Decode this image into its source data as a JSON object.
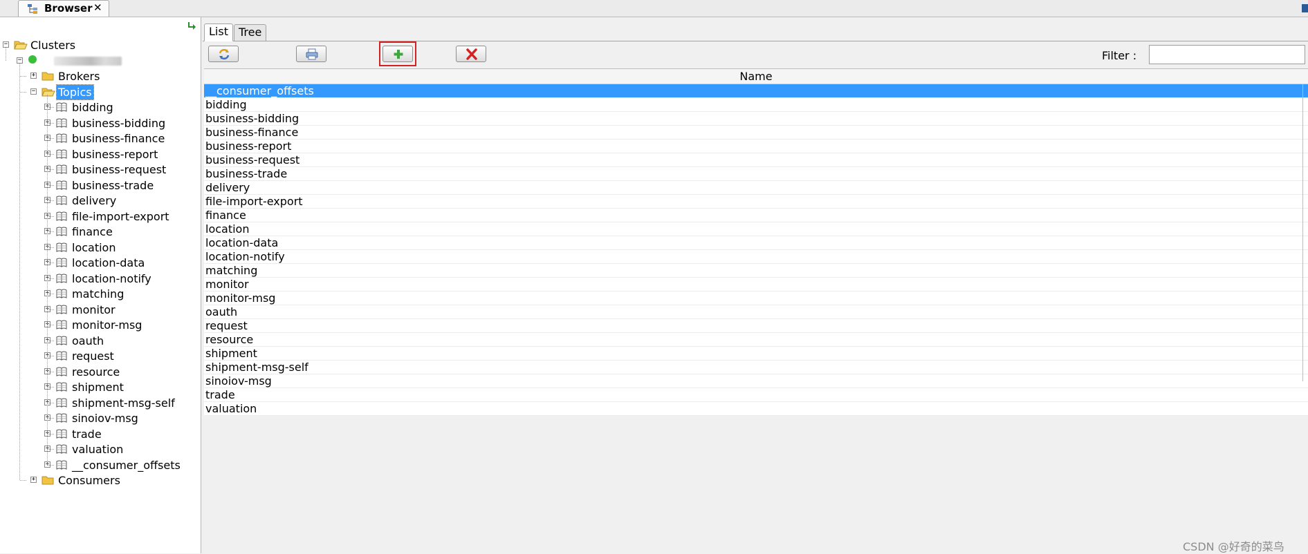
{
  "topbar": {
    "tab_label": "Browser",
    "close_glyph": "✕"
  },
  "tree": {
    "clusters_label": "Clusters",
    "brokers_label": "Brokers",
    "topics_label": "Topics",
    "consumers_label": "Consumers",
    "topics": [
      "bidding",
      "business-bidding",
      "business-finance",
      "business-report",
      "business-request",
      "business-trade",
      "delivery",
      "file-import-export",
      "finance",
      "location",
      "location-data",
      "location-notify",
      "matching",
      "monitor",
      "monitor-msg",
      "oauth",
      "request",
      "resource",
      "shipment",
      "shipment-msg-self",
      "sinoiov-msg",
      "trade",
      "valuation",
      "__consumer_offsets"
    ]
  },
  "view_tabs": {
    "list": "List",
    "tree": "Tree"
  },
  "toolbar": {
    "filter_label": "Filter :",
    "filter_value": "",
    "icons": [
      "refresh-icon",
      "print-icon",
      "add-icon",
      "delete-icon"
    ]
  },
  "grid": {
    "column_header": "Name",
    "selected_index": 0,
    "rows": [
      "__consumer_offsets",
      "bidding",
      "business-bidding",
      "business-finance",
      "business-report",
      "business-request",
      "business-trade",
      "delivery",
      "file-import-export",
      "finance",
      "location",
      "location-data",
      "location-notify",
      "matching",
      "monitor",
      "monitor-msg",
      "oauth",
      "request",
      "resource",
      "shipment",
      "shipment-msg-self",
      "sinoiov-msg",
      "trade",
      "valuation"
    ]
  },
  "colors": {
    "selection": "#3399ff",
    "highlight_border": "#d32020",
    "cluster_status": "#3bbf3b"
  },
  "watermark": "CSDN @好奇的菜鸟"
}
